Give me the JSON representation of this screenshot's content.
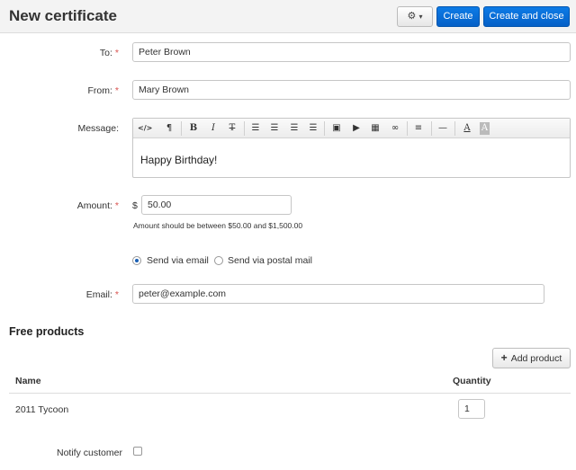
{
  "header": {
    "title": "New certificate",
    "gear_icon": "gear-icon",
    "gear_caret": "▾",
    "create_label": "Create",
    "create_close_label": "Create and close"
  },
  "form": {
    "to": {
      "label": "To:",
      "value": "Peter Brown"
    },
    "from": {
      "label": "From:",
      "value": "Mary Brown"
    },
    "message": {
      "label": "Message:",
      "body": "Happy Birthday!",
      "toolbar": [
        "</>",
        "¶",
        "B",
        "I",
        "T",
        "bulleted-list",
        "numbered-list",
        "outdent",
        "indent",
        "image",
        "video",
        "table",
        "link",
        "align",
        "horizontal-rule",
        "font-color",
        "background-color"
      ]
    },
    "amount": {
      "label": "Amount:",
      "currency": "$",
      "value": "50.00",
      "hint": "Amount should be between $50.00 and $1,500.00"
    },
    "delivery": {
      "options": [
        "Send via email",
        "Send via postal mail"
      ],
      "selected": "Send via email"
    },
    "email": {
      "label": "Email:",
      "value": "peter@example.com"
    },
    "required_mark": "*"
  },
  "free_products": {
    "title": "Free products",
    "add_label": "Add product",
    "add_icon": "+",
    "columns": [
      "Name",
      "Quantity"
    ],
    "rows": [
      {
        "name": "2011 Tycoon",
        "quantity": "1"
      }
    ]
  },
  "notify": {
    "label": "Notify customer",
    "checked": false
  },
  "colors": {
    "primary": "#0a6fd8",
    "required": "#d9534f",
    "header_bg": "#f3f3f3"
  }
}
